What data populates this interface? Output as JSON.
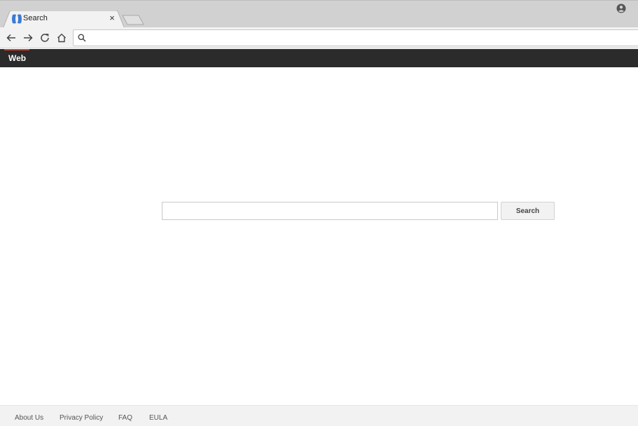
{
  "browser": {
    "tab": {
      "title": "Search",
      "favicon": "site-favicon-icon",
      "close_glyph": "×"
    },
    "omnibox": {
      "value": "",
      "placeholder": ""
    }
  },
  "site": {
    "nav": {
      "web_label": "Web"
    },
    "search": {
      "query": "",
      "placeholder": "",
      "button_label": "Search"
    },
    "footer": {
      "links": [
        "About Us",
        "Privacy Policy",
        "FAQ",
        "EULA"
      ]
    }
  },
  "colors": {
    "site_bar": "#2b2b2b",
    "accent": "#d93a2b",
    "favicon_blue": "#3a7bd5",
    "footer_bg": "#f2f2f2"
  }
}
